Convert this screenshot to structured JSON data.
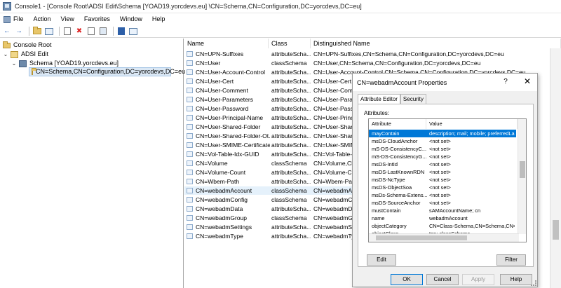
{
  "window": {
    "title": "Console1 - [Console Root\\ADSI Edit\\Schema [YOAD19.yorcdevs.eu] \\CN=Schema,CN=Configuration,DC=yorcdevs,DC=eu]"
  },
  "menu": [
    "File",
    "Action",
    "View",
    "Favorites",
    "Window",
    "Help"
  ],
  "tree": {
    "items": [
      {
        "label": "Console Root"
      },
      {
        "label": "ADSI Edit"
      },
      {
        "label": "Schema [YOAD19.yorcdevs.eu]"
      },
      {
        "label": "CN=Schema,CN=Configuration,DC=yorcdevs,DC=eu"
      }
    ]
  },
  "list": {
    "headers": [
      "Name",
      "Class",
      "Distinguished Name"
    ],
    "rows": [
      {
        "name": "CN=UPN-Suffixes",
        "class": "attributeScha...",
        "dn": "CN=UPN-Suffixes,CN=Schema,CN=Configuration,DC=yorcdevs,DC=eu"
      },
      {
        "name": "CN=User",
        "class": "classSchema",
        "dn": "CN=User,CN=Schema,CN=Configuration,DC=yorcdevs,DC=eu"
      },
      {
        "name": "CN=User-Account-Control",
        "class": "attributeScha...",
        "dn": "CN=User-Account-Control,CN=Schema,CN=Configuration,DC=yorcdevs,DC=eu"
      },
      {
        "name": "CN=User-Cert",
        "class": "attributeScha...",
        "dn": "CN=User-Cert,"
      },
      {
        "name": "CN=User-Comment",
        "class": "attributeScha...",
        "dn": "CN=User-Comm"
      },
      {
        "name": "CN=User-Parameters",
        "class": "attributeScha...",
        "dn": "CN=User-Para"
      },
      {
        "name": "CN=User-Password",
        "class": "attributeScha...",
        "dn": "CN=User-Passv"
      },
      {
        "name": "CN=User-Principal-Name",
        "class": "attributeScha...",
        "dn": "CN=User-Princ"
      },
      {
        "name": "CN=User-Shared-Folder",
        "class": "attributeScha...",
        "dn": "CN=User-Share"
      },
      {
        "name": "CN=User-Shared-Folder-Ot...",
        "class": "attributeScha...",
        "dn": "CN=User-Share"
      },
      {
        "name": "CN=User-SMIME-Certificate",
        "class": "attributeScha...",
        "dn": "CN=User-SMIM"
      },
      {
        "name": "CN=Vol-Table-Idx-GUID",
        "class": "attributeScha...",
        "dn": "CN=Vol-Table-"
      },
      {
        "name": "CN=Volume",
        "class": "classSchema",
        "dn": "CN=Volume,CN"
      },
      {
        "name": "CN=Volume-Count",
        "class": "attributeScha...",
        "dn": "CN=Volume-C"
      },
      {
        "name": "CN=Wbem-Path",
        "class": "attributeScha...",
        "dn": "CN=Wbem-Pat"
      },
      {
        "name": "CN=webadmAccount",
        "class": "classSchema",
        "dn": "CN=webadmA"
      },
      {
        "name": "CN=webadmConfig",
        "class": "classSchema",
        "dn": "CN=webadmC"
      },
      {
        "name": "CN=webadmData",
        "class": "attributeScha...",
        "dn": "CN=webadmD"
      },
      {
        "name": "CN=webadmGroup",
        "class": "classSchema",
        "dn": "CN=webadmGr"
      },
      {
        "name": "CN=webadmSettings",
        "class": "attributeScha...",
        "dn": "CN=webadmSe"
      },
      {
        "name": "CN=webadmType",
        "class": "attributeScha...",
        "dn": "CN=webadmTy"
      }
    ]
  },
  "dialog": {
    "title": "CN=webadmAccount Properties",
    "help": "?",
    "close": "✕",
    "tabs": [
      "Attribute Editor",
      "Security"
    ],
    "attributes_label": "Attributes:",
    "headers": [
      "Attribute",
      "Value"
    ],
    "rows": [
      {
        "name": "mayContain",
        "value": "description; mail; mobile; preferredLanguage;"
      },
      {
        "name": "msDS-CloudAnchor",
        "value": "<not set>"
      },
      {
        "name": "mS-DS-ConsistencyC...",
        "value": "<not set>"
      },
      {
        "name": "mS-DS-ConsistencyG...",
        "value": "<not set>"
      },
      {
        "name": "msDS-IntId",
        "value": "<not set>"
      },
      {
        "name": "msDS-LastKnownRDN",
        "value": "<not set>"
      },
      {
        "name": "msDS-NcType",
        "value": "<not set>"
      },
      {
        "name": "msDS-ObjectSoa",
        "value": "<not set>"
      },
      {
        "name": "msDs-Schema-Extens...",
        "value": "<not set>"
      },
      {
        "name": "msDS-SourceAnchor",
        "value": "<not set>"
      },
      {
        "name": "mustContain",
        "value": "sAMAccountName; cn"
      },
      {
        "name": "name",
        "value": "webadmAccount"
      },
      {
        "name": "objectCategory",
        "value": "CN=Class-Schema,CN=Schema,CN=Configu"
      },
      {
        "name": "objectClass",
        "value": "top; classSchema"
      }
    ],
    "edit": "Edit",
    "filter": "Filter",
    "ok": "OK",
    "cancel": "Cancel",
    "apply": "Apply",
    "help_button": "Help"
  }
}
